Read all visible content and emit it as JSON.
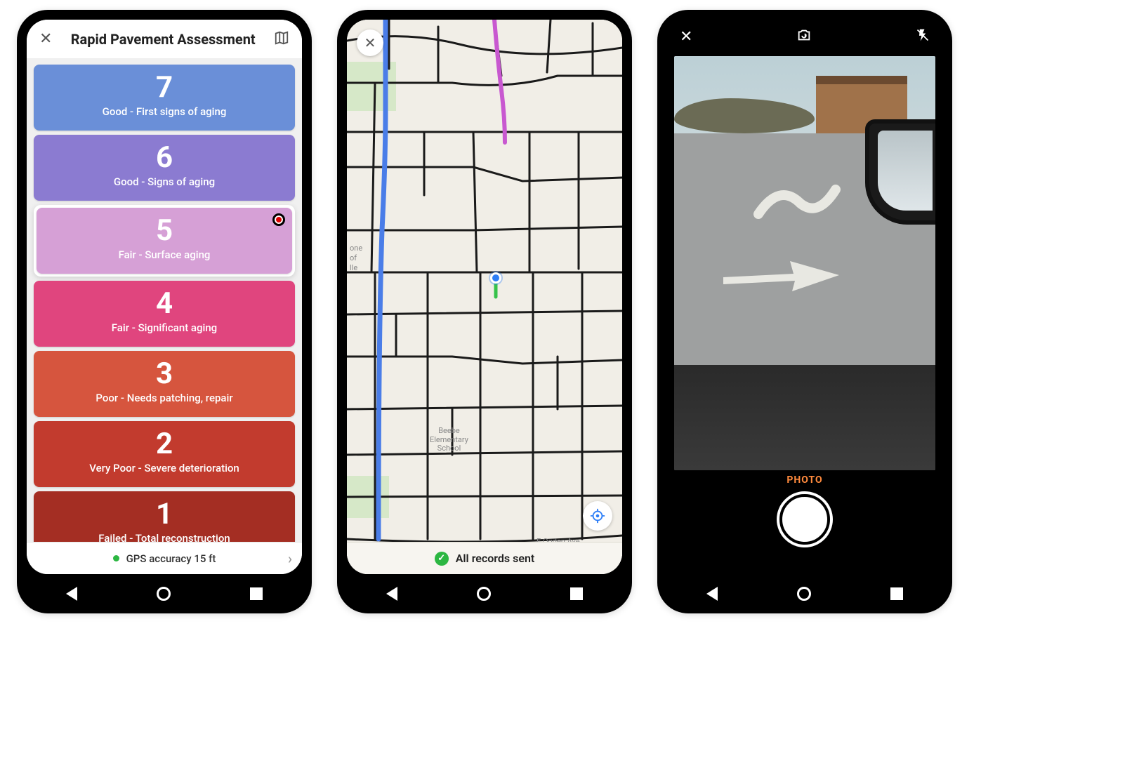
{
  "phone1": {
    "title": "Rapid Pavement Assessment",
    "options": [
      {
        "num": "7",
        "desc": "Good  - First signs of aging",
        "color": "#6a8fd8"
      },
      {
        "num": "6",
        "desc": "Good - Signs of aging",
        "color": "#8b7bd1"
      },
      {
        "num": "5",
        "desc": "Fair - Surface aging",
        "color": "#d6a0d6",
        "selected": true
      },
      {
        "num": "4",
        "desc": "Fair - Significant aging",
        "color": "#e0457e"
      },
      {
        "num": "3",
        "desc": "Poor - Needs patching, repair",
        "color": "#d6553e"
      },
      {
        "num": "2",
        "desc": "Very Poor - Severe deterioration",
        "color": "#c23b2e"
      },
      {
        "num": "1",
        "desc": "Failed - Total reconstruction",
        "color": "#a42e23"
      }
    ],
    "footer": "GPS accuracy 15 ft"
  },
  "phone2": {
    "footer": "All records sent",
    "poi_school": "Beebe\nElementary\nSchool",
    "poi_left1": "one",
    "poi_left2": "of",
    "poi_left3": "lle",
    "street_ogden": "E Ogden Ave"
  },
  "phone3": {
    "mode": "PHOTO"
  }
}
